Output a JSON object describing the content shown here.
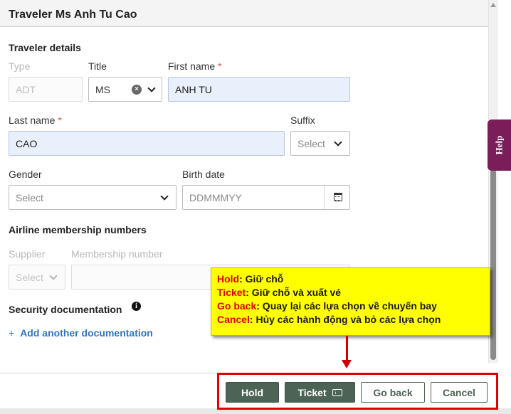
{
  "header": {
    "title": "Traveler Ms Anh Tu Cao"
  },
  "help": {
    "label": "Help"
  },
  "traveler_details": {
    "title": "Traveler details",
    "type": {
      "label": "Type",
      "value": "ADT"
    },
    "title_field": {
      "label": "Title",
      "value": "MS"
    },
    "first_name": {
      "label": "First name",
      "required_mark": "*",
      "value": "ANH TU"
    },
    "last_name": {
      "label": "Last name",
      "required_mark": "*",
      "value": "CAO"
    },
    "suffix": {
      "label": "Suffix",
      "placeholder": "Select"
    },
    "gender": {
      "label": "Gender",
      "placeholder": "Select"
    },
    "birth_date": {
      "label": "Birth date",
      "placeholder": "DDMMMYY"
    }
  },
  "membership": {
    "title": "Airline membership numbers",
    "supplier": {
      "label": "Supplier",
      "placeholder": "Select"
    },
    "number": {
      "label": "Membership number"
    }
  },
  "security": {
    "title": "Security documentation",
    "add_label": "Add another documentation"
  },
  "callout": {
    "lines": [
      {
        "term": "Hold",
        "text": ": Giữ chỗ"
      },
      {
        "term": "Ticket",
        "text": ": Giữ chỗ và xuất vé"
      },
      {
        "term": "Go back",
        "text": ": Quay lại các lựa chọn về chuyến bay"
      },
      {
        "term": "Cancel",
        "text": ": Hủy các hành động và bỏ các lựa chọn"
      }
    ]
  },
  "actions": {
    "hold": "Hold",
    "ticket": "Ticket",
    "go_back": "Go back",
    "cancel": "Cancel"
  },
  "colors": {
    "primary_button": "#4d6355",
    "help_tab": "#7a1d59",
    "callout_bg": "#ffff00",
    "callout_term": "#e00000",
    "highlight": "#e00000",
    "link": "#2f74c0"
  }
}
